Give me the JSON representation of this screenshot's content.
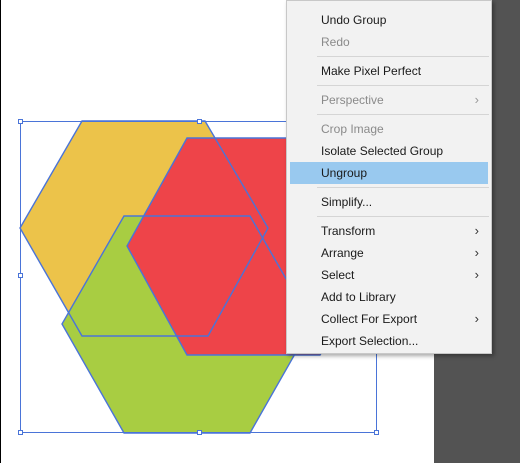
{
  "colors": {
    "hex_yellow": "#ecc34a",
    "hex_red": "#ee4449",
    "hex_green": "#a8cd42",
    "selection_outline": "#4a74d8",
    "menu_highlight": "#99c9ef",
    "pasteboard": "#535353"
  },
  "context_menu": {
    "items": [
      {
        "label": "Undo Group",
        "enabled": true
      },
      {
        "label": "Redo",
        "enabled": false
      },
      {
        "label": "Make Pixel Perfect",
        "enabled": true
      },
      {
        "label": "Perspective",
        "enabled": false,
        "submenu": true
      },
      {
        "label": "Crop Image",
        "enabled": false
      },
      {
        "label": "Isolate Selected Group",
        "enabled": true
      },
      {
        "label": "Ungroup",
        "enabled": true,
        "highlighted": true
      },
      {
        "label": "Simplify...",
        "enabled": true
      },
      {
        "label": "Transform",
        "enabled": true,
        "submenu": true
      },
      {
        "label": "Arrange",
        "enabled": true,
        "submenu": true
      },
      {
        "label": "Select",
        "enabled": true,
        "submenu": true
      },
      {
        "label": "Add to Library",
        "enabled": true
      },
      {
        "label": "Collect For Export",
        "enabled": true,
        "submenu": true
      },
      {
        "label": "Export Selection...",
        "enabled": true
      }
    ],
    "chevron_icon": "chevron-right-icon"
  }
}
